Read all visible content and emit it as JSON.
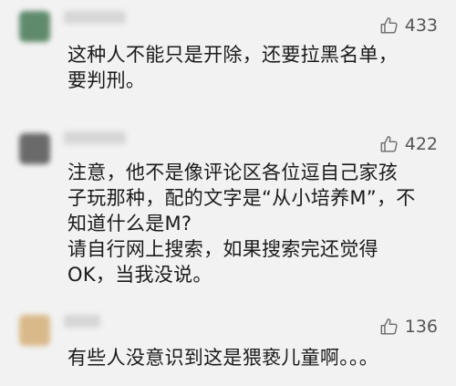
{
  "comments": [
    {
      "likes": "433",
      "lines": [
        "这种人不能只是开除，还要拉黑名单，",
        "要判刑。"
      ]
    },
    {
      "likes": "422",
      "lines": [
        "注意，他不是像评论区各位逗自己家孩",
        "子玩那种，配的文字是“从小培养M”，不",
        "知道什么是M?",
        "请自行网上搜索，如果搜索完还觉得",
        "OK，当我没说。"
      ]
    },
    {
      "likes": "136",
      "lines": [
        "有些人没意识到这是猥亵儿童啊。。。"
      ]
    }
  ],
  "icons": {
    "like": "thumbs-up-outline-icon"
  },
  "colors": {
    "background": "#f2f2f2",
    "text": "#1a1a1a",
    "like_count": "#555555"
  }
}
